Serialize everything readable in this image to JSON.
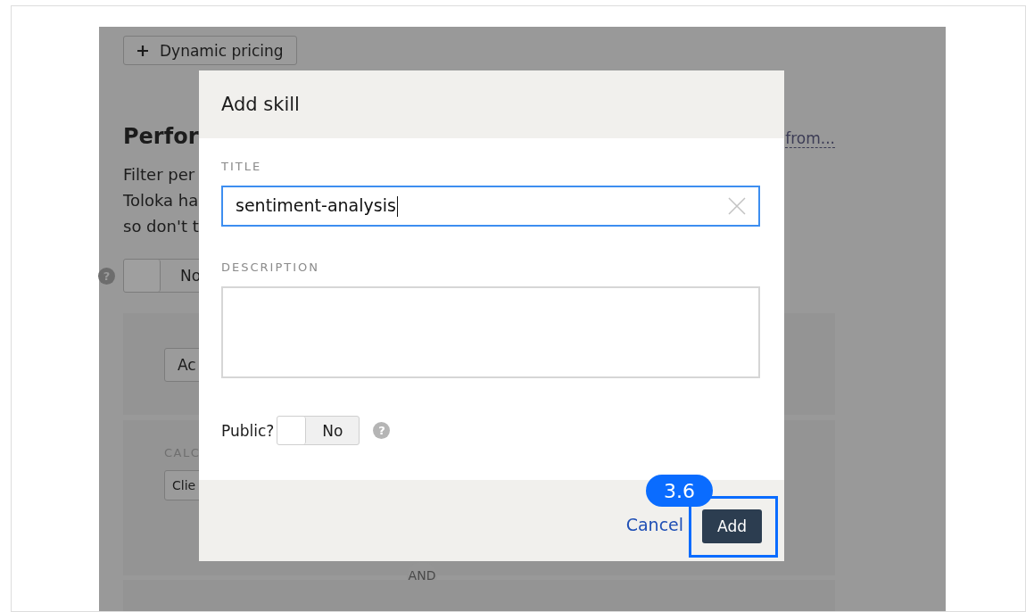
{
  "background": {
    "pricing_button": "Dynamic pricing",
    "heading": "Perfor",
    "heading_link": "from...",
    "description_lines": [
      "Filter per",
      "Toloka ha",
      "so don't t"
    ],
    "help_mark": "?",
    "toggle": {
      "label": "No",
      "on": false
    },
    "panel_button": "Ac",
    "calc_label": "CALC",
    "calc_button": "Clie",
    "conjunction": "AND"
  },
  "dialog": {
    "title": "Add skill",
    "fields": [
      {
        "kind": "input",
        "label": "TITLE",
        "value": "sentiment-analysis",
        "focused": true
      },
      {
        "kind": "textarea",
        "label": "DESCRIPTION",
        "focused": false
      }
    ],
    "public": {
      "label": "Public?",
      "state_text": "No",
      "on": false,
      "help_mark": "?"
    },
    "buttons": [
      {
        "kind": "link",
        "label": "Cancel",
        "highlighted": false
      },
      {
        "kind": "primary",
        "label": "Add",
        "highlighted": true
      }
    ]
  },
  "annotation": {
    "label": "3.6"
  }
}
